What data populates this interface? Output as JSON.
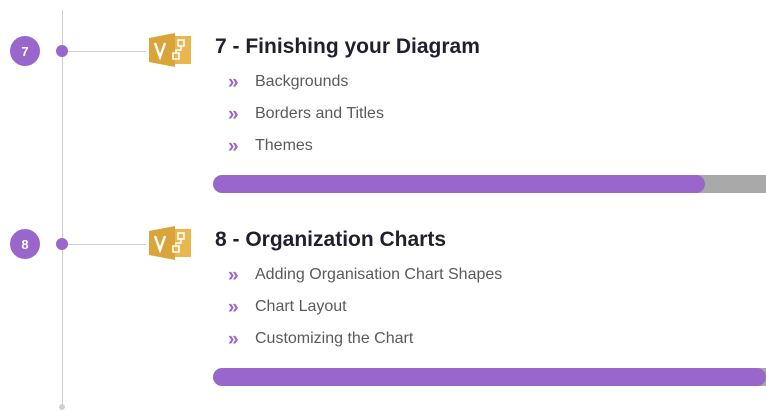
{
  "theme": {
    "accent": "#9966cc",
    "track": "#a9a9a9",
    "icon_gold": "#e8b84f"
  },
  "icons": {
    "app": "visio-app-icon",
    "bullet": "double-chevron-right-icon"
  },
  "modules": [
    {
      "number": "7",
      "title": "7 - Finishing your Diagram",
      "lessons": [
        "Backgrounds",
        "Borders and Titles",
        "Themes"
      ],
      "progress": 0.89
    },
    {
      "number": "8",
      "title": "8 - Organization Charts",
      "lessons": [
        "Adding Organisation Chart Shapes",
        "Chart Layout",
        "Customizing the Chart"
      ],
      "progress": 1.0
    }
  ]
}
